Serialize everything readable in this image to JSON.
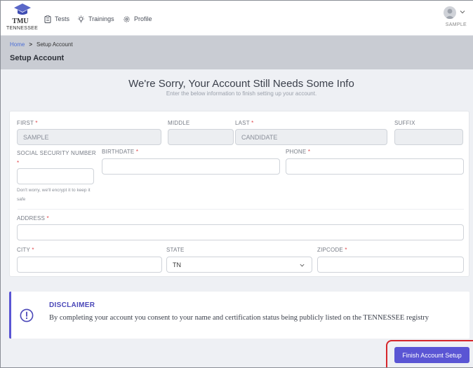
{
  "logo": {
    "abbr": "TMU",
    "state": "TENNESSEE"
  },
  "nav": {
    "tests": "Tests",
    "trainings": "Trainings",
    "profile": "Profile"
  },
  "user": {
    "name": "SAMPLE"
  },
  "breadcrumb": {
    "home": "Home",
    "separator": ">",
    "current": "Setup Account"
  },
  "page": {
    "title": "Setup Account"
  },
  "banner": {
    "heading": "We're Sorry, Your Account Still Needs Some Info",
    "subheading": "Enter the below information to finish setting up your account."
  },
  "form": {
    "first": {
      "label": "FIRST",
      "required": "*",
      "value": "SAMPLE"
    },
    "middle": {
      "label": "MIDDLE",
      "value": ""
    },
    "last": {
      "label": "LAST",
      "required": "*",
      "value": "CANDIDATE"
    },
    "suffix": {
      "label": "SUFFIX",
      "value": ""
    },
    "ssn": {
      "label": "SOCIAL SECURITY NUMBER",
      "required": "*",
      "value": "",
      "help": "Don't worry, we'll encrypt it to keep it safe"
    },
    "birthdate": {
      "label": "BIRTHDATE",
      "required": "*",
      "value": ""
    },
    "phone": {
      "label": "PHONE",
      "required": "*",
      "value": ""
    },
    "address": {
      "label": "ADDRESS",
      "required": "*",
      "value": ""
    },
    "city": {
      "label": "CITY",
      "required": "*",
      "value": ""
    },
    "state": {
      "label": "STATE",
      "value": "TN"
    },
    "zipcode": {
      "label": "ZIPCODE",
      "required": "*",
      "value": ""
    }
  },
  "disclaimer": {
    "title": "DISCLAIMER",
    "text": "By completing your account you consent to your name and certification status being publicly listed on the TENNESSEE registry"
  },
  "actions": {
    "finish": "Finish Account Setup"
  },
  "colors": {
    "accent": "#5a55d4",
    "required": "#e0454b",
    "link": "#4c6fd6",
    "highlight": "#d6262b"
  }
}
